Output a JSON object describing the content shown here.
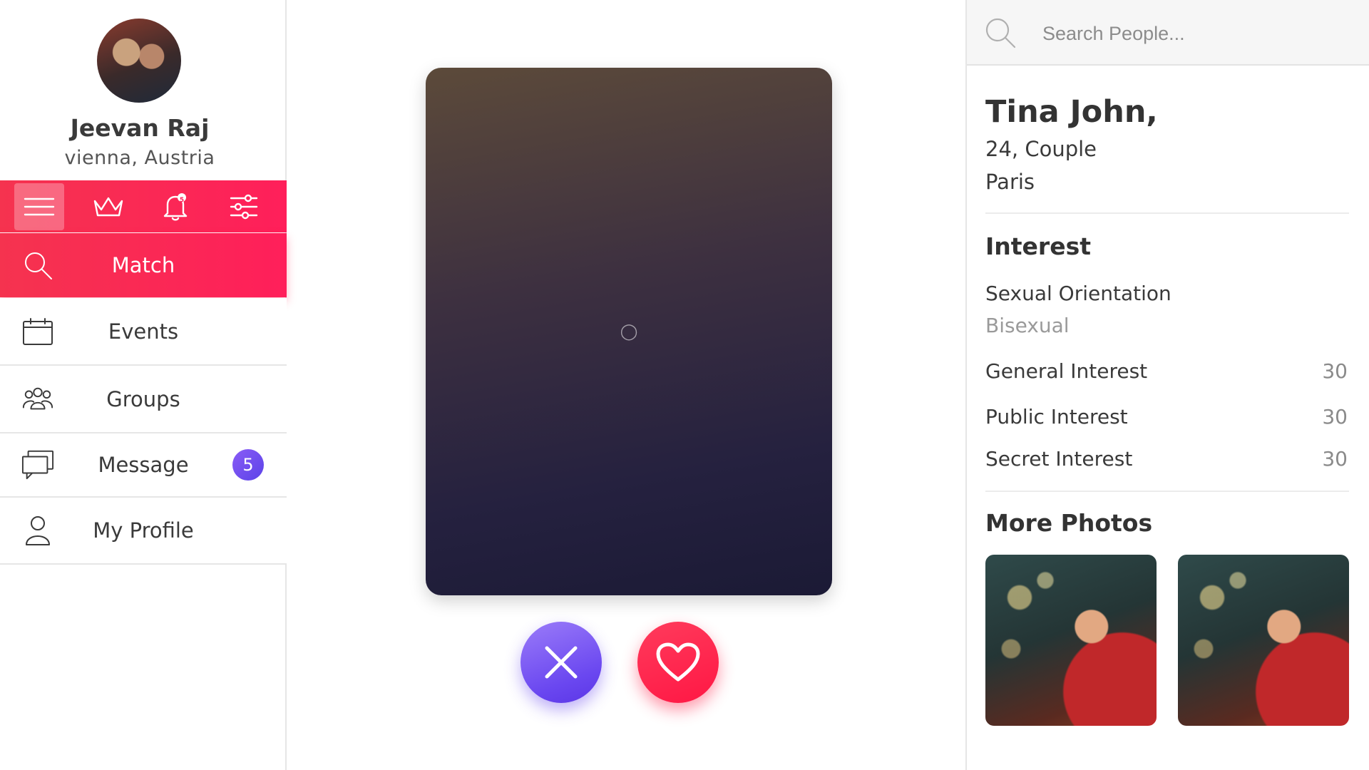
{
  "user": {
    "name": "Jeevan Raj",
    "location": "vienna, Austria"
  },
  "toolbar": {
    "notification_count": "5"
  },
  "nav": {
    "items": [
      {
        "label": "Match"
      },
      {
        "label": "Events"
      },
      {
        "label": "Groups"
      },
      {
        "label": "Message",
        "badge": "5"
      },
      {
        "label": "My Profile"
      }
    ]
  },
  "search": {
    "placeholder": "Search People..."
  },
  "profile": {
    "name": "Tina John,",
    "meta": "24, Couple",
    "city": "Paris"
  },
  "interest": {
    "title": "Interest",
    "orientation_label": "Sexual Orientation",
    "orientation_value": "Bisexual",
    "rows": [
      {
        "label": "General Interest",
        "value": "30"
      },
      {
        "label": "Public Interest",
        "value": "30"
      },
      {
        "label": "Secret Interest",
        "value": "30"
      }
    ]
  },
  "more_photos": {
    "title": "More Photos"
  },
  "colors": {
    "accent": "#ff1f5a",
    "purple": "#6a47f0",
    "badge": "#5b43e8"
  },
  "icons": [
    "menu-icon",
    "crown-icon",
    "bell-icon",
    "sliders-icon",
    "search-icon",
    "calendar-icon",
    "group-icon",
    "chat-icon",
    "user-icon",
    "close-icon",
    "heart-icon"
  ]
}
